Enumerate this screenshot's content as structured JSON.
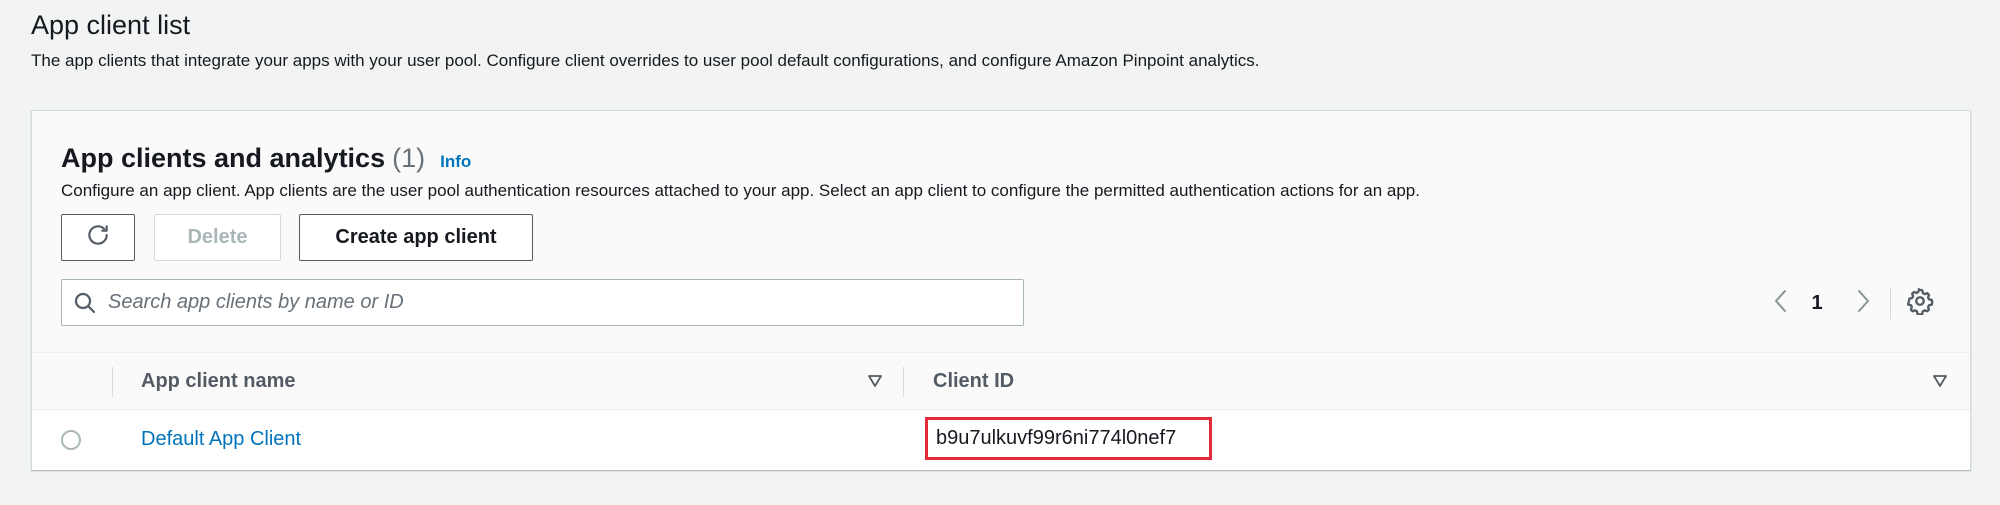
{
  "section": {
    "title": "App client list",
    "description": "The app clients that integrate your apps with your user pool. Configure client overrides to user pool default configurations, and configure Amazon Pinpoint analytics."
  },
  "panel": {
    "title": "App clients and analytics",
    "count": "(1)",
    "info_label": "Info",
    "description": "Configure an app client. App clients are the user pool authentication resources attached to your app. Select an app client to configure the permitted authentication actions for an app."
  },
  "toolbar": {
    "refresh_icon": "refresh-icon",
    "delete_label": "Delete",
    "create_label": "Create app client"
  },
  "search": {
    "placeholder": "Search app clients by name or ID",
    "value": ""
  },
  "pagination": {
    "current_page": "1"
  },
  "table": {
    "columns": [
      "App client name",
      "Client ID"
    ],
    "rows": [
      {
        "name": "Default App Client",
        "client_id": "b9u7ulkuvf99r6ni774l0nef7"
      }
    ]
  },
  "colors": {
    "link": "#0073bb",
    "highlight": "#e4293a",
    "text": "#16191f",
    "muted": "#545b64"
  }
}
